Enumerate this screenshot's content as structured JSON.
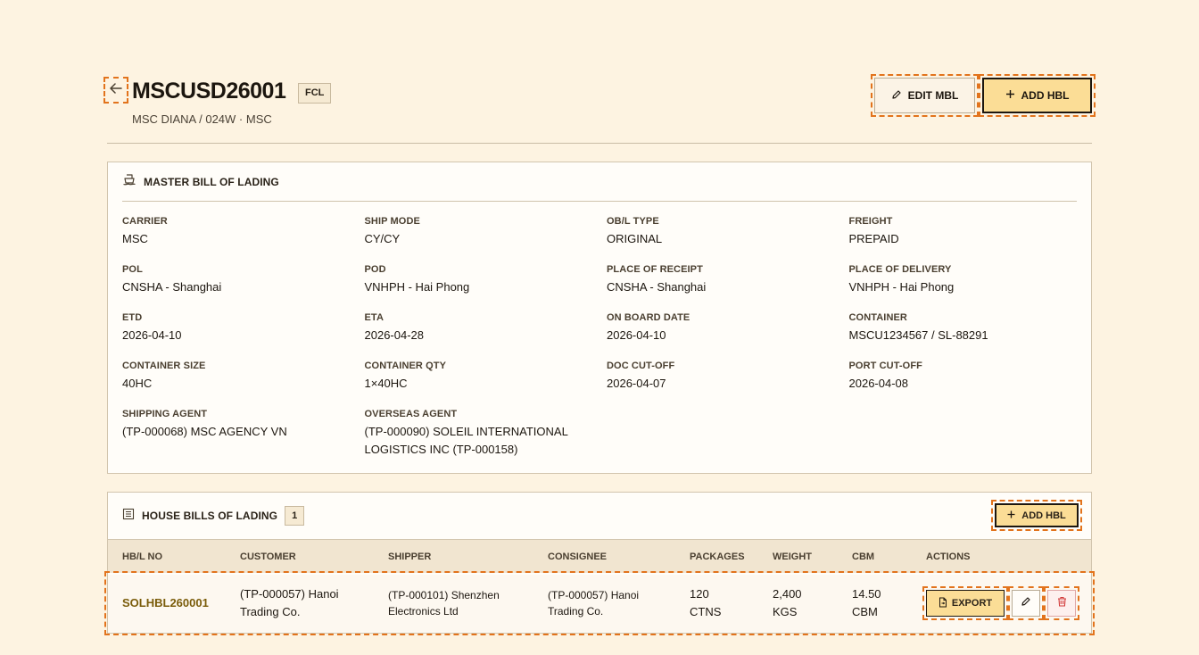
{
  "header": {
    "title": "MSCUSD26001",
    "badge": "FCL",
    "subtitle": "MSC DIANA / 024W · MSC",
    "edit_label": "EDIT MBL",
    "add_label": "ADD HBL"
  },
  "mbl": {
    "title": "MASTER BILL OF LADING",
    "fields": [
      {
        "label": "CARRIER",
        "value": "MSC"
      },
      {
        "label": "SHIP MODE",
        "value": "CY/CY"
      },
      {
        "label": "OB/L TYPE",
        "value": "ORIGINAL"
      },
      {
        "label": "FREIGHT",
        "value": "PREPAID"
      },
      {
        "label": "POL",
        "value": "CNSHA - Shanghai"
      },
      {
        "label": "POD",
        "value": "VNHPH - Hai Phong"
      },
      {
        "label": "PLACE OF RECEIPT",
        "value": "CNSHA - Shanghai"
      },
      {
        "label": "PLACE OF DELIVERY",
        "value": "VNHPH - Hai Phong"
      },
      {
        "label": "ETD",
        "value": "2026-04-10"
      },
      {
        "label": "ETA",
        "value": "2026-04-28"
      },
      {
        "label": "ON BOARD DATE",
        "value": "2026-04-10"
      },
      {
        "label": "CONTAINER",
        "value": "MSCU1234567 / SL-88291"
      },
      {
        "label": "CONTAINER SIZE",
        "value": "40HC"
      },
      {
        "label": "CONTAINER QTY",
        "value": "1×40HC"
      },
      {
        "label": "DOC CUT-OFF",
        "value": "2026-04-07"
      },
      {
        "label": "PORT CUT-OFF",
        "value": "2026-04-08"
      },
      {
        "label": "SHIPPING AGENT",
        "value": "(TP-000068) MSC AGENCY VN"
      },
      {
        "label": "OVERSEAS AGENT",
        "value": "(TP-000090) SOLEIL INTERNATIONAL LOGISTICS INC (TP-000158)"
      }
    ]
  },
  "hbl": {
    "title": "HOUSE BILLS OF LADING",
    "count": "1",
    "add_label": "ADD HBL",
    "columns": [
      "HB/L NO",
      "CUSTOMER",
      "SHIPPER",
      "CONSIGNEE",
      "PACKAGES",
      "WEIGHT",
      "CBM",
      "ACTIONS"
    ],
    "rows": [
      {
        "no": "SOLHBL260001",
        "customer": "(TP-000057) Hanoi Trading Co.",
        "shipper": "(TP-000101) Shenzhen Electronics Ltd",
        "consignee": "(TP-000057) Hanoi Trading Co.",
        "packages": "120 CTNS",
        "weight": "2,400 KGS",
        "cbm": "14.50 CBM",
        "export_label": "EXPORT"
      }
    ]
  }
}
